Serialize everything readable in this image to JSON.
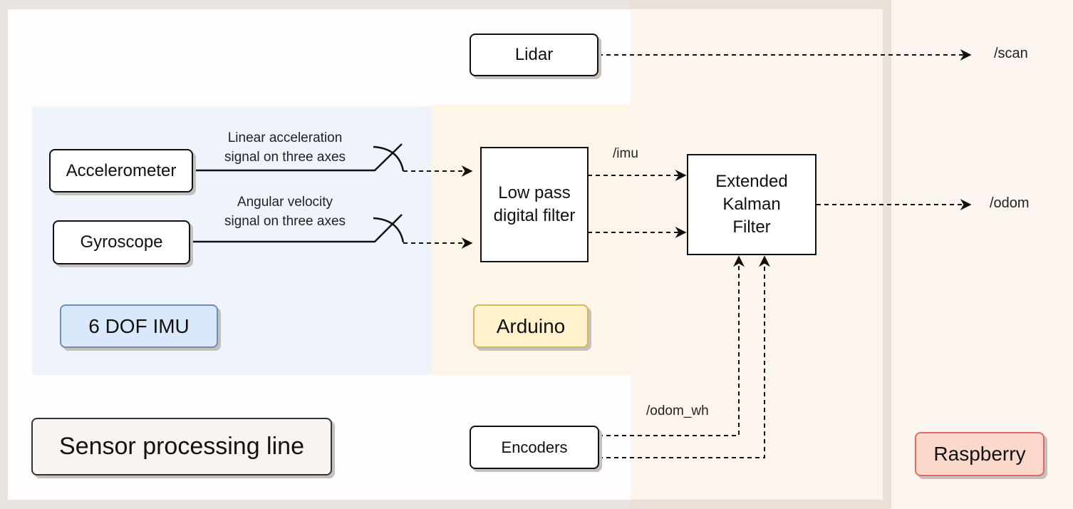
{
  "diagram": {
    "title": "Sensor processing line",
    "groups": {
      "imu": {
        "label": "6 DOF IMU",
        "fill": "#dae8fc",
        "stroke": "#6c8ebf",
        "bg": "#eef3fc"
      },
      "arduino": {
        "label": "Arduino",
        "fill": "#fff2cc",
        "stroke": "#d6b656",
        "bg": "#fdf6e8"
      },
      "raspberry": {
        "label": "Raspberry",
        "fill": "#fad9cb",
        "stroke": "#e06b66",
        "bg": "#fdf4ee"
      }
    },
    "nodes": {
      "lidar": "Lidar",
      "accelerometer": "Accelerometer",
      "gyroscope": "Gyroscope",
      "low_pass_filter": "Low pass digital filter",
      "ekf": "Extended Kalman Filter",
      "encoders": "Encoders"
    },
    "edge_labels": {
      "accel_signal_line1": "Linear acceleration",
      "accel_signal_line2": "signal on three axes",
      "gyro_signal_line1": "Angular velocity",
      "gyro_signal_line2": "signal on three axes",
      "imu_topic": "/imu",
      "odom_wh_topic": "/odom_wh"
    },
    "outputs": {
      "scan": "/scan",
      "odom": "/odom"
    },
    "edges": [
      {
        "from": "lidar",
        "to": "/scan",
        "style": "dashed"
      },
      {
        "from": "accelerometer",
        "to": "low_pass_filter",
        "style": "switch+dashed"
      },
      {
        "from": "gyroscope",
        "to": "low_pass_filter",
        "style": "switch+dashed"
      },
      {
        "from": "low_pass_filter",
        "to": "ekf",
        "label": "/imu",
        "style": "dashed"
      },
      {
        "from": "low_pass_filter",
        "to": "ekf",
        "style": "dashed"
      },
      {
        "from": "ekf",
        "to": "/odom",
        "style": "dashed"
      },
      {
        "from": "encoders",
        "to": "ekf",
        "label": "/odom_wh",
        "style": "dashed"
      },
      {
        "from": "encoders",
        "to": "ekf",
        "style": "dashed"
      }
    ]
  }
}
